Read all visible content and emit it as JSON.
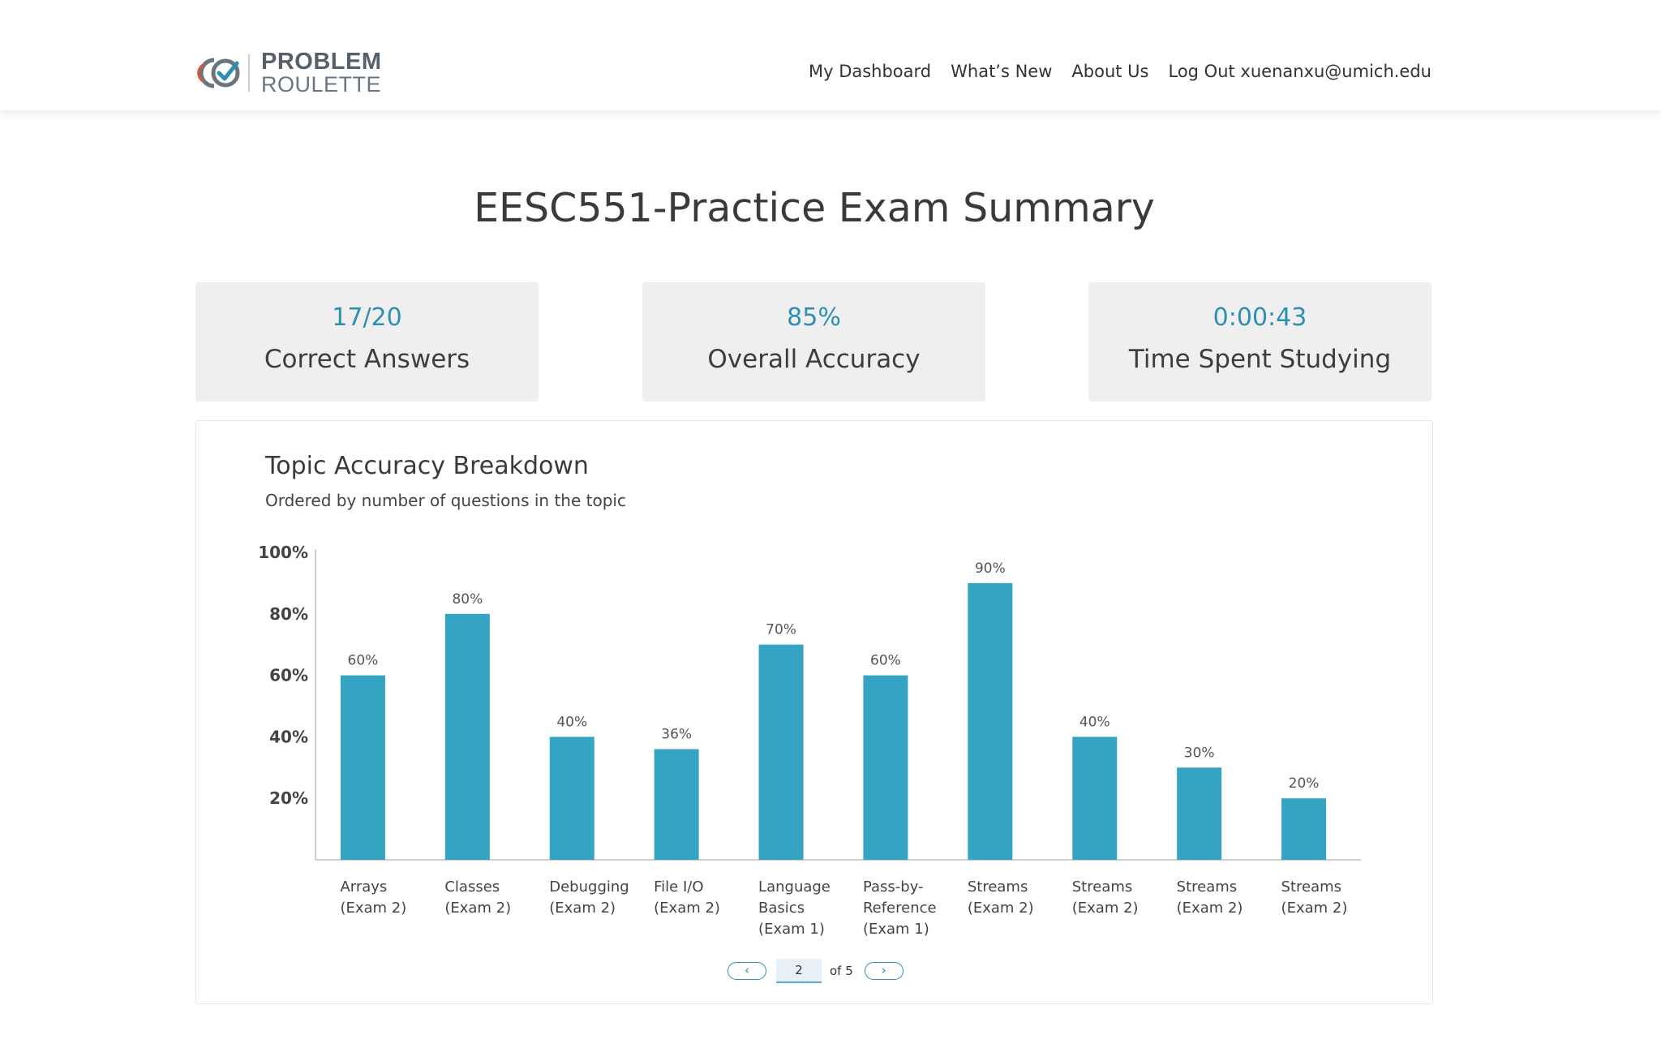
{
  "nav": {
    "brand_line1": "PROBLEM",
    "brand_line2": "ROULETTE",
    "links": [
      "My Dashboard",
      "What’s New",
      "About Us",
      "Log Out xuenanxu@umich.edu"
    ]
  },
  "page_title": "EESC551-Practice Exam Summary",
  "stats": [
    {
      "value": "17/20",
      "label": "Correct Answers"
    },
    {
      "value": "85%",
      "label": "Overall Accuracy"
    },
    {
      "value": "0:00:43",
      "label": "Time Spent Studying"
    }
  ],
  "colors": {
    "accent": "#2e8fb3",
    "bar": "#35a3c2",
    "stat_bg": "#efefef"
  },
  "chart_data": {
    "type": "bar",
    "title": "Topic Accuracy Breakdown",
    "subtitle": "Ordered by number of questions in the topic",
    "categories": [
      [
        "Arrays",
        "(Exam 2)"
      ],
      [
        "Classes",
        "(Exam 2)"
      ],
      [
        "Debugging",
        "(Exam 2)"
      ],
      [
        "File I/O",
        "(Exam 2)"
      ],
      [
        "Language",
        "Basics",
        "(Exam 1)"
      ],
      [
        "Pass-by-",
        "Reference",
        "(Exam 1)"
      ],
      [
        "Streams",
        "(Exam 2)"
      ],
      [
        "Streams",
        "(Exam 2)"
      ],
      [
        "Streams",
        "(Exam 2)"
      ],
      [
        "Streams",
        "(Exam 2)"
      ]
    ],
    "values": [
      60,
      80,
      40,
      36,
      70,
      60,
      90,
      40,
      30,
      20
    ],
    "value_labels": [
      "60%",
      "80%",
      "40%",
      "36%",
      "70%",
      "60%",
      "90%",
      "40%",
      "30%",
      "20%"
    ],
    "y_ticks": [
      20,
      40,
      60,
      80,
      100
    ],
    "y_tick_labels": [
      "20%",
      "40%",
      "60%",
      "80%",
      "100%"
    ],
    "ylim": [
      0,
      100
    ],
    "grid": false
  },
  "pager": {
    "page": "2",
    "of_label": "of 5",
    "prev": "‹",
    "next": "›"
  }
}
